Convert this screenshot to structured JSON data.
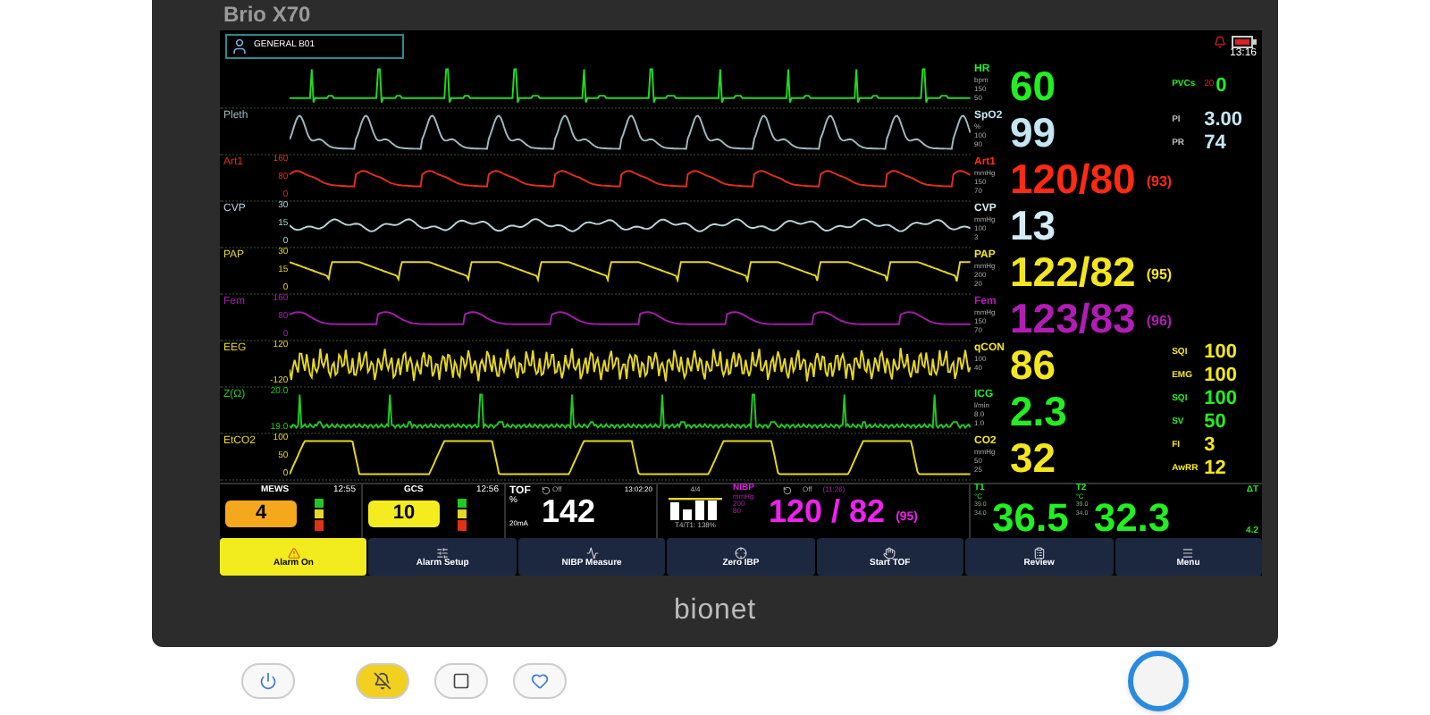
{
  "device": {
    "brand": "Brio X70",
    "logo": "bionet"
  },
  "header": {
    "patient": "GENERAL B01",
    "time": "13:16"
  },
  "waves": [
    {
      "kind": "ecg",
      "color": "#22d822"
    },
    {
      "kind": "pleth",
      "label": "Pleth",
      "color": "#9fb8c2"
    },
    {
      "kind": "art",
      "label": "Art1",
      "color": "#e0301c",
      "scales": [
        "160",
        "80",
        "0"
      ]
    },
    {
      "kind": "cvp",
      "label": "CVP",
      "color": "#b9d3dd",
      "scales": [
        "30",
        "15",
        "0"
      ]
    },
    {
      "kind": "pap",
      "label": "PAP",
      "color": "#e6d722",
      "scales": [
        "30",
        "15",
        "0"
      ]
    },
    {
      "kind": "fem",
      "label": "Fem",
      "color": "#a21ea8",
      "scales": [
        "160",
        "80",
        "0"
      ]
    },
    {
      "kind": "eeg",
      "label": "EEG",
      "color": "#e6d722",
      "scales": [
        "120",
        "-120"
      ]
    },
    {
      "kind": "z",
      "label": "Z(Ω)",
      "color": "#22c822",
      "scales": [
        "20.0",
        "19.0"
      ]
    },
    {
      "kind": "co2",
      "label": "EtCO2",
      "color": "#e6d722",
      "scales": [
        "100",
        "50",
        "0"
      ]
    }
  ],
  "params": [
    {
      "label": "HR",
      "color": "#22ee22",
      "unit": "bpm",
      "limits": [
        "150",
        "50"
      ],
      "value": "60",
      "side": [
        {
          "label": "PVCs",
          "value": "0",
          "note": "20"
        }
      ]
    },
    {
      "label": "SpO2",
      "color": "#c4e6f4",
      "unit": "%",
      "limits": [
        "100",
        "90"
      ],
      "value": "99",
      "side": [
        {
          "label": "PI",
          "value": "3.00"
        },
        {
          "label": "PR",
          "value": "74"
        }
      ]
    },
    {
      "label": "Art1",
      "color": "#ff2a14",
      "unit": "mmHg",
      "limits": [
        "150",
        "70"
      ],
      "value": "120/80",
      "mean": "(93)"
    },
    {
      "label": "CVP",
      "color": "#d4ecf6",
      "unit": "mmHg",
      "limits": [
        "100",
        "3"
      ],
      "value": "13"
    },
    {
      "label": "PAP",
      "color": "#f4e61e",
      "unit": "mmHg",
      "limits": [
        "200",
        "20"
      ],
      "value": "122/82",
      "mean": "(95)"
    },
    {
      "label": "Fem",
      "color": "#b21cb6",
      "unit": "mmHg",
      "limits": [
        "150",
        "70"
      ],
      "value": "123/83",
      "mean": "(96)"
    },
    {
      "label": "qCON",
      "color": "#f4e61e",
      "limits": [
        "100",
        "40"
      ],
      "value": "86",
      "side": [
        {
          "label": "SQI",
          "value": "100"
        },
        {
          "label": "EMG",
          "value": "100"
        }
      ]
    },
    {
      "label": "ICG",
      "color": "#22ee22",
      "unit": "l/min",
      "limits": [
        "8.0",
        "1.0"
      ],
      "value": "2.3",
      "side": [
        {
          "label": "SQI",
          "value": "100"
        },
        {
          "label": "SV",
          "value": "50"
        }
      ]
    },
    {
      "label": "CO2",
      "color": "#f4e61e",
      "unit": "mmHg",
      "limits": [
        "50",
        "25"
      ],
      "value": "32",
      "side": [
        {
          "label": "FI",
          "value": "3"
        },
        {
          "label": "AwRR",
          "value": "12"
        }
      ]
    }
  ],
  "scores": [
    {
      "label": "MEWS",
      "time": "12:55",
      "value": "4",
      "color": "#f5a81c"
    },
    {
      "label": "GCS",
      "time": "12:56",
      "value": "10",
      "color": "#f4ec1e"
    }
  ],
  "tof": {
    "label": "TOF",
    "unit": "%",
    "current": "20mA",
    "mode": "Off",
    "time": "13:02:20",
    "value": "142",
    "count": "4/4",
    "ratio": "T4/T1: 138%"
  },
  "nibp": {
    "label": "NIBP",
    "unit": "mmHg",
    "limits": [
      "200",
      "80"
    ],
    "mode": "Off",
    "time": "(11:26)",
    "value": "120 / 82",
    "mean": "(95)"
  },
  "temps": {
    "t1": {
      "label": "T1",
      "unit": "°C",
      "limits": [
        "39.0",
        "34.0"
      ],
      "value": "36.5"
    },
    "t2": {
      "label": "T2",
      "unit": "°C",
      "limits": [
        "39.0",
        "34.0"
      ],
      "value": "32.3"
    },
    "delta_label": "ΔT",
    "delta": "4.2"
  },
  "buttons": [
    {
      "kind": "alarm",
      "label": "Alarm On",
      "selected": true
    },
    {
      "kind": "setup",
      "label": "Alarm Setup",
      "selected": false
    },
    {
      "kind": "nibp",
      "label": "NIBP Measure",
      "selected": false
    },
    {
      "kind": "zero",
      "label": "Zero IBP",
      "selected": false
    },
    {
      "kind": "tof",
      "label": "Start TOF",
      "selected": false
    },
    {
      "kind": "review",
      "label": "Review",
      "selected": false
    },
    {
      "kind": "menu",
      "label": "Menu",
      "selected": false
    }
  ]
}
